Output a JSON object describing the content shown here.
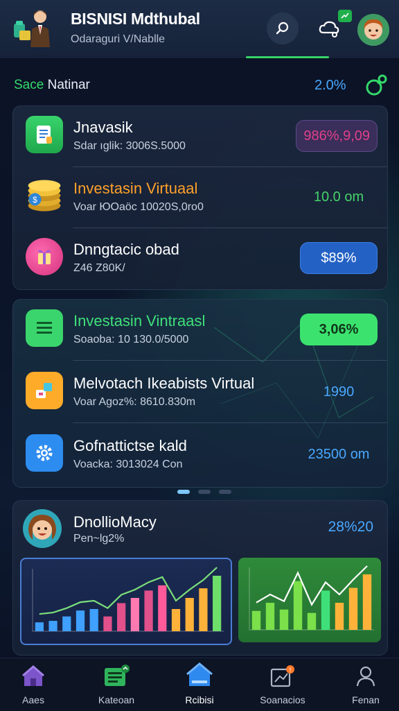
{
  "header": {
    "title": "BISNISI Mdthubal",
    "subtitle": "Odaraguri V/Nablle"
  },
  "section": {
    "label_green": "Sace",
    "label_rest": " Natinar",
    "value": "2.0%"
  },
  "card1": {
    "rows": [
      {
        "title": "Jnavasik",
        "sub": "Sdar ıglik: 3006S.5000",
        "value": "986%,9,09",
        "title_color": "#ffffff",
        "value_color": "#e0408a"
      },
      {
        "title": "Investasin Virtuaal",
        "sub": "Voar ЮOaöc 10020S,0ro0",
        "value": "10.0 om",
        "title_color": "#ffa02a",
        "value_color": "#45d36a"
      },
      {
        "title": "Dnngtacic obad",
        "sub": "Z46 Z80K/",
        "value": "$89%",
        "title_color": "#ffffff",
        "value_color": "#ffffff"
      }
    ]
  },
  "card2": {
    "rows": [
      {
        "title": "Investasin Vintraasl",
        "sub": "Soaoba: 10 130.0/5000",
        "value": "3,06%",
        "title_color": "#3fe07a",
        "value_color": "#10351a"
      },
      {
        "title": "Melvotach Ikeabists Virtual",
        "sub": "Voar Agoz%: 8610.830m",
        "value": "1990",
        "title_color": "#ffffff",
        "value_color": "#4aa8ff"
      },
      {
        "title": "Gofnattictse kald",
        "sub": "Voacka: 3013024 Con",
        "value": "23500 om",
        "title_color": "#ffffff",
        "value_color": "#4aa8ff"
      }
    ]
  },
  "card3": {
    "title": "DnollioMacy",
    "sub": "Pen~lg2%",
    "value": "28%20"
  },
  "chart_data": [
    {
      "type": "bar",
      "values": [
        12,
        14,
        20,
        28,
        30,
        20,
        38,
        45,
        55,
        62,
        30,
        45,
        58,
        75
      ]
    },
    {
      "type": "bar",
      "values": [
        28,
        40,
        30,
        72,
        25,
        58,
        40,
        62,
        82
      ]
    }
  ],
  "nav": {
    "items": [
      {
        "label": "Aaes"
      },
      {
        "label": "Kateoan"
      },
      {
        "label": "Rcibisi"
      },
      {
        "label": "Soanacios"
      },
      {
        "label": "Fenan"
      }
    ]
  },
  "colors": {
    "accent_green": "#36d46a",
    "accent_blue": "#4aa8ff"
  }
}
